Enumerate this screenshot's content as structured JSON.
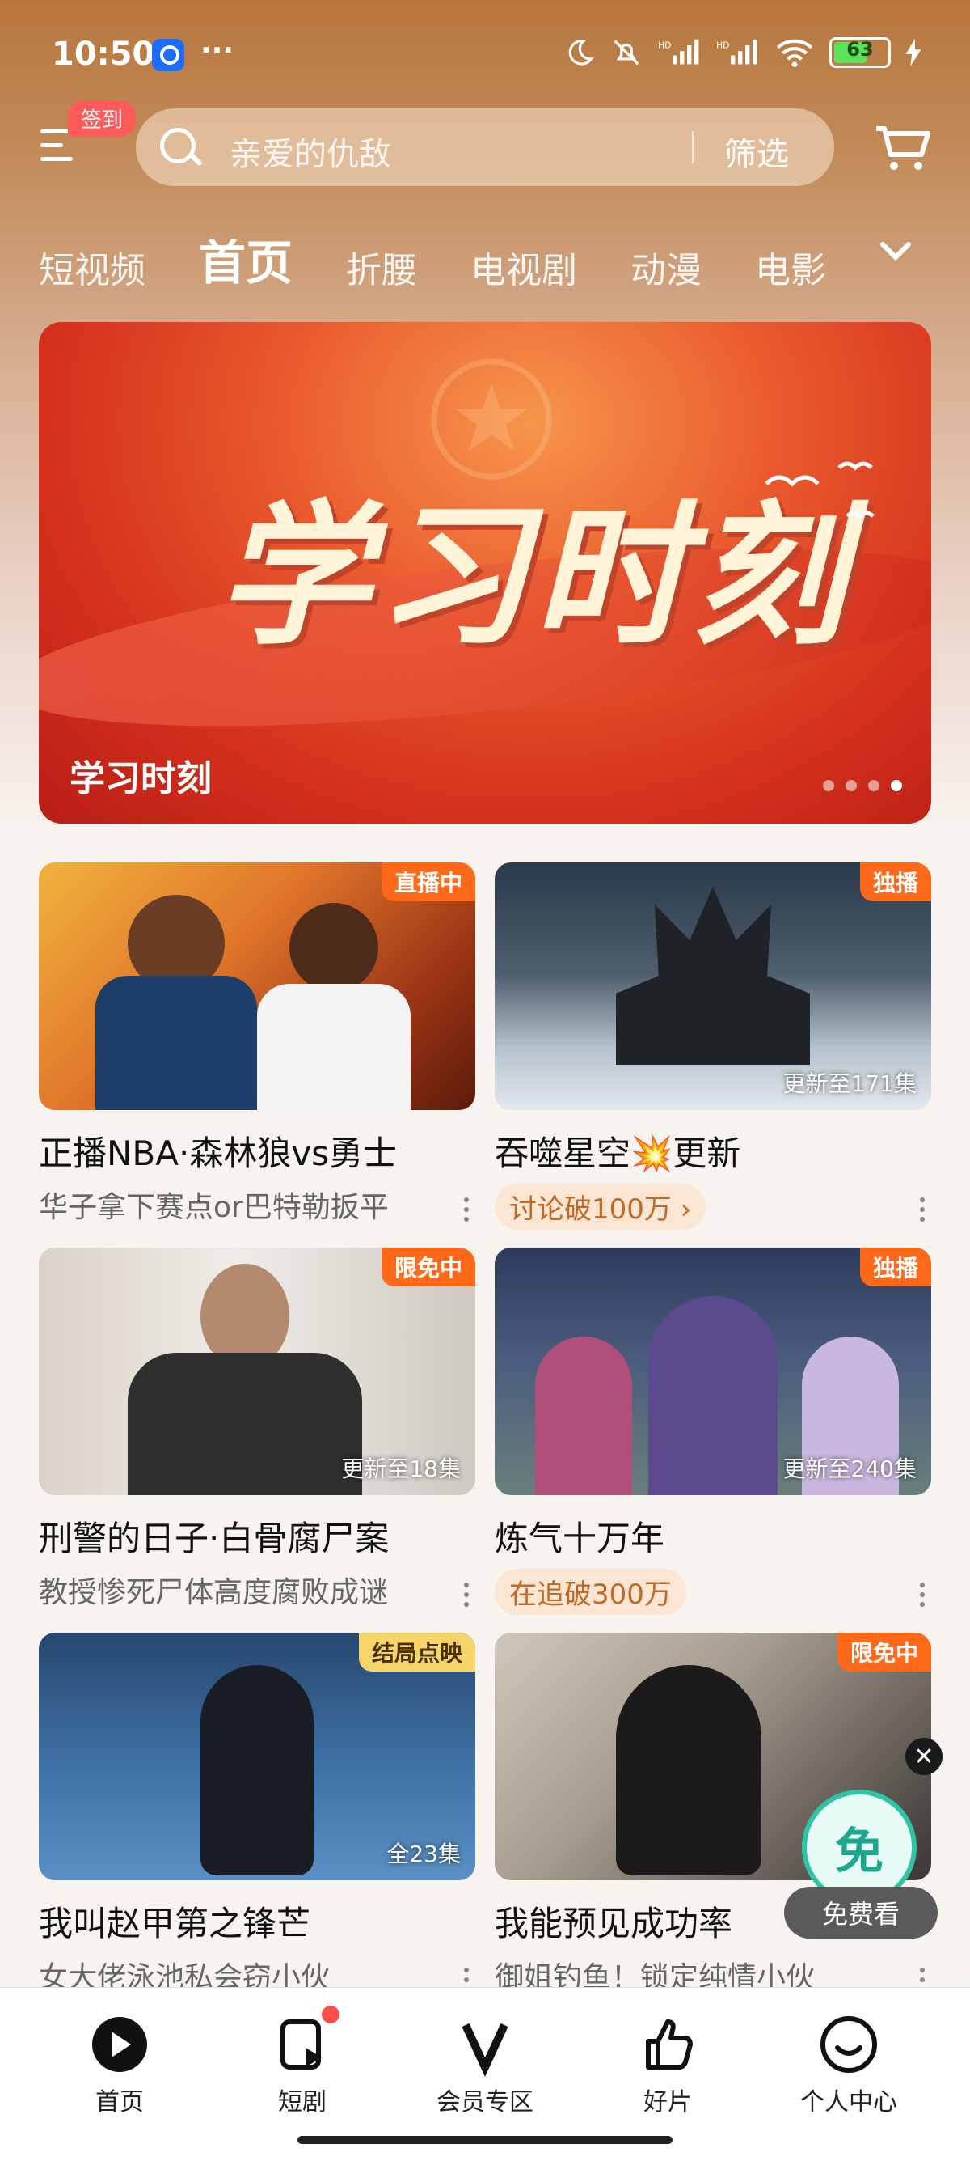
{
  "status_bar": {
    "time": "10:50",
    "more": "···",
    "battery": "63",
    "battery_level": 0.63
  },
  "header": {
    "checkin_label": "签到",
    "search_placeholder": "亲爱的仇敌",
    "filter_label": "筛选"
  },
  "tabs": [
    "短视频",
    "首页",
    "折腰",
    "电视剧",
    "动漫",
    "电影"
  ],
  "active_tab": "首页",
  "banner": {
    "artwork_text": "学习时刻",
    "caption": "学习时刻",
    "pages": 4,
    "active_page": 4
  },
  "cards": [
    {
      "title": "正播NBA·森林狼vs勇士",
      "subtitle": "华子拿下赛点or巴特勒扳平",
      "badge": "直播中",
      "episodes": ""
    },
    {
      "title": "吞噬星空💥更新",
      "pill": "讨论破100万 ›",
      "badge": "独播",
      "episodes": "更新至171集"
    },
    {
      "title": "刑警的日子·白骨腐尸案",
      "subtitle": "教授惨死尸体高度腐败成谜",
      "badge": "限免中",
      "episodes": "更新至18集"
    },
    {
      "title": "炼气十万年",
      "pill": "在追破300万",
      "badge": "独播",
      "episodes": "更新至240集"
    },
    {
      "title": "我叫赵甲第之锋芒",
      "subtitle": "女大佬泳池私会窃小伙",
      "badge": "结局点映",
      "episodes": "全23集"
    },
    {
      "title": "我能预见成功率",
      "subtitle": "御姐钓鱼！锁定纯情小伙",
      "badge": "限免中",
      "episodes": ""
    }
  ],
  "free_watch": {
    "icon_text": "免",
    "button_label": "免费看",
    "close": "✕"
  },
  "bottom_nav": [
    {
      "label": "首页",
      "icon": "play-logo-icon"
    },
    {
      "label": "短剧",
      "icon": "short-drama-icon"
    },
    {
      "label": "会员专区",
      "icon": "vip-icon"
    },
    {
      "label": "好片",
      "icon": "thumbs-up-icon"
    },
    {
      "label": "个人中心",
      "icon": "profile-icon"
    }
  ],
  "colors": {
    "accent_orange": "#ff6a1a",
    "badge_yellow": "#f5d56a",
    "pill_bg": "#fbe6d3",
    "pill_text": "#c26a25",
    "header_brown": "#b7763d"
  }
}
